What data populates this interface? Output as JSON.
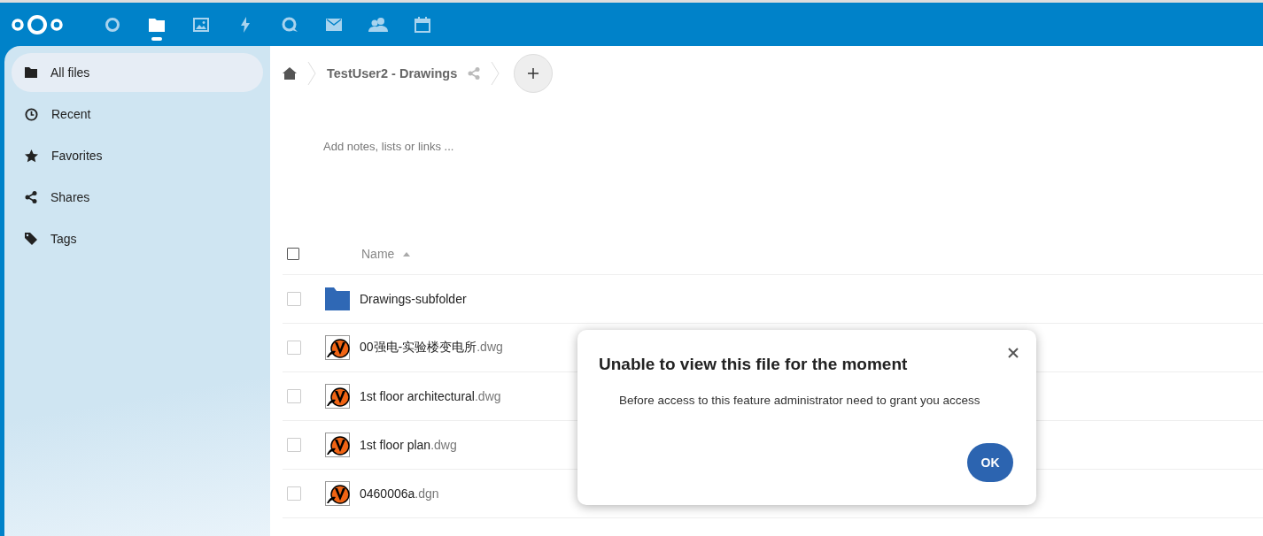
{
  "header": {
    "apps": [
      {
        "kind": "dashboard",
        "selected": false
      },
      {
        "kind": "files",
        "selected": true
      },
      {
        "kind": "photos",
        "selected": false
      },
      {
        "kind": "activity",
        "selected": false
      },
      {
        "kind": "talk",
        "selected": false
      },
      {
        "kind": "mail",
        "selected": false
      },
      {
        "kind": "contacts",
        "selected": false
      },
      {
        "kind": "calendar",
        "selected": false
      }
    ]
  },
  "sidebar": {
    "items": [
      {
        "label": "All files",
        "kind": "folder",
        "selected": true
      },
      {
        "label": "Recent",
        "kind": "clock",
        "selected": false
      },
      {
        "label": "Favorites",
        "kind": "star",
        "selected": false
      },
      {
        "label": "Shares",
        "kind": "share",
        "selected": false
      },
      {
        "label": "Tags",
        "kind": "tag",
        "selected": false
      }
    ]
  },
  "breadcrumb": {
    "folder": "TestUser2 - Drawings"
  },
  "notes": {
    "placeholder": "Add notes, lists or links ..."
  },
  "table": {
    "select_all_checked": false,
    "columns": [
      {
        "label": "Name"
      }
    ],
    "rows": [
      {
        "name": "Drawings-subfolder",
        "ext": "",
        "kind": "folder",
        "checked": false
      },
      {
        "name": "00强电-实验楼变电所",
        "ext": ".dwg",
        "kind": "drawing",
        "checked": false
      },
      {
        "name": "1st floor architectural",
        "ext": ".dwg",
        "kind": "drawing",
        "checked": false
      },
      {
        "name": "1st floor plan",
        "ext": ".dwg",
        "kind": "drawing",
        "checked": false
      },
      {
        "name": "0460006a",
        "ext": ".dgn",
        "kind": "drawing",
        "checked": false
      }
    ]
  },
  "dialog": {
    "title": "Unable to view this file for the moment",
    "message": "Before access to this feature administrator need to grant you access",
    "button": "OK"
  }
}
